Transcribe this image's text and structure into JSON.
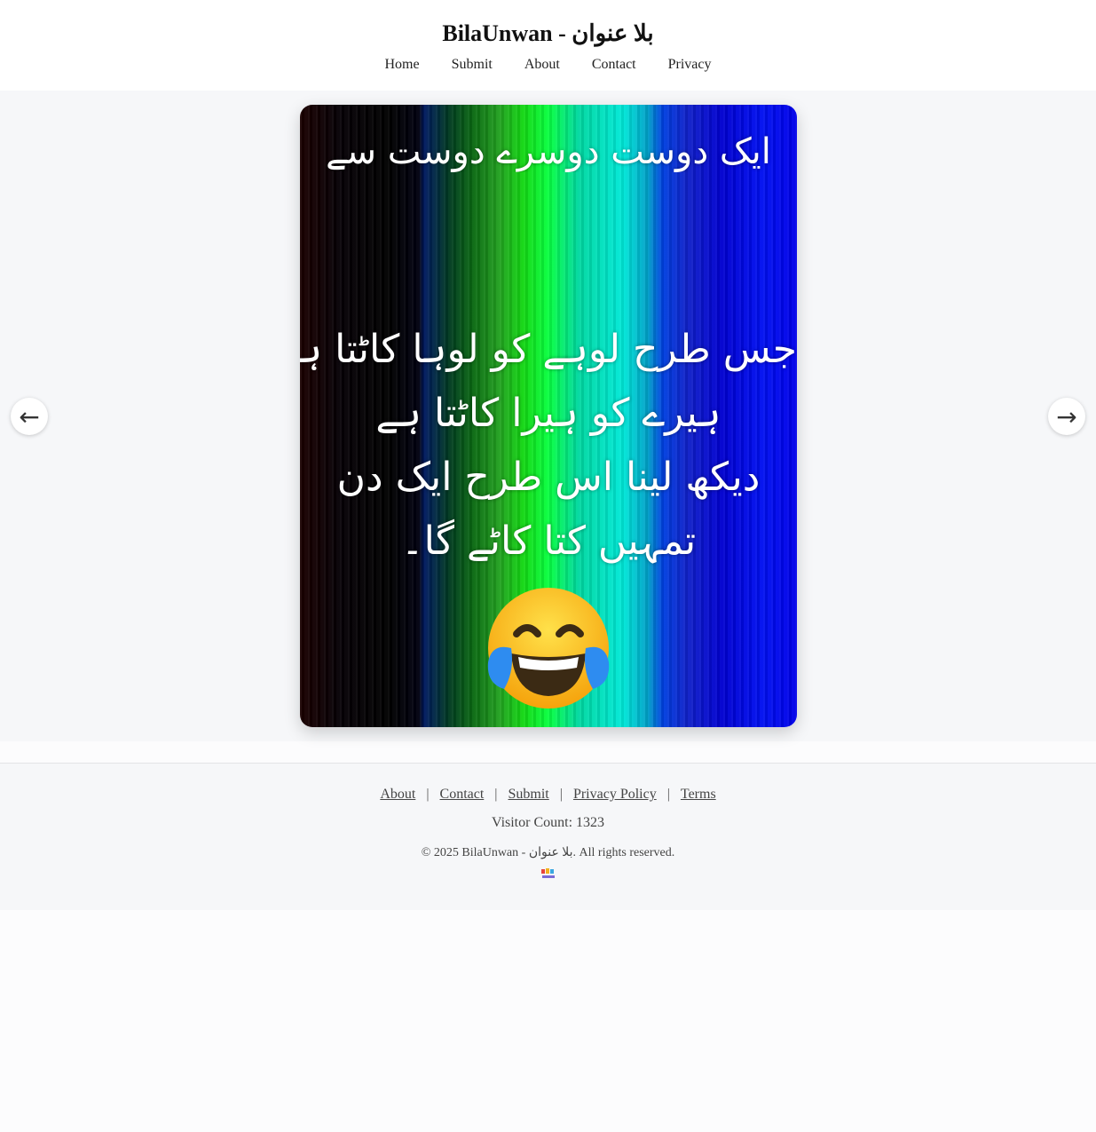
{
  "header": {
    "brand": "BilaUnwan - بلا عنوان",
    "nav": [
      "Home",
      "Submit",
      "About",
      "Contact",
      "Privacy"
    ]
  },
  "carousel": {
    "slide_lines_top": "ایک دوست دوسرے دوست سے",
    "slide_lines_main": [
      "جس طرح لوہے کو لوہا کاٹتا ہے",
      "ہیرے کو ہیرا کاٹتا ہے",
      "دیکھ لینا اس طرح ایک دن",
      "تمہیں کتا کاٹے گا۔"
    ],
    "prev_icon": "←",
    "next_icon": "→"
  },
  "footer": {
    "links": [
      "About",
      "Contact",
      "Submit",
      "Privacy Policy",
      "Terms"
    ],
    "separator": "|",
    "visitor_count": "Visitor Count: 1323",
    "copyright": "© 2025 BilaUnwan - بلا عنوان. All rights reserved."
  },
  "colors": {
    "header_bg": "#ffffff",
    "carousel_bg": "#f6f7f9",
    "footer_bg": "#f6f7f9"
  },
  "icons": {
    "prev": "arrow-left-icon",
    "next": "arrow-right-icon",
    "emoji": "tears-of-joy-emoji",
    "logo": "site-logo-icon"
  }
}
